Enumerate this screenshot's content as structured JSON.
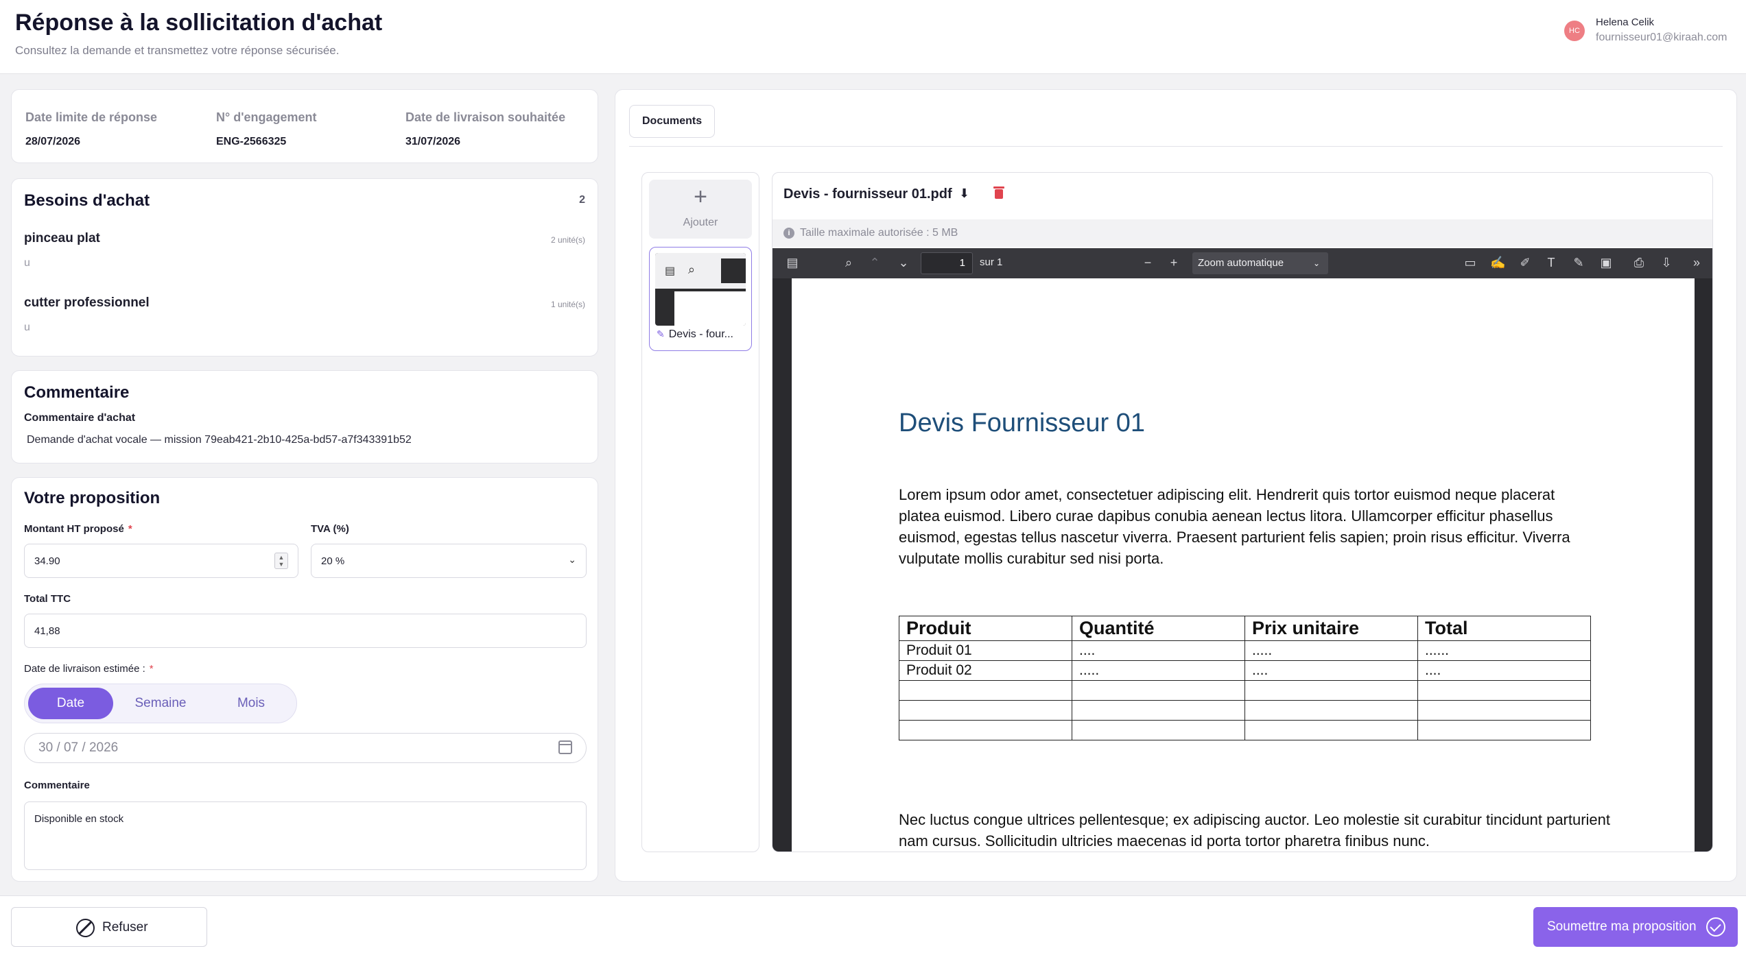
{
  "header": {
    "title": "Réponse à la sollicitation d'achat",
    "subtitle": "Consultez la demande et transmettez votre réponse sécurisée.",
    "user": {
      "initials": "HC",
      "name": "Helena Celik",
      "email": "fournisseur01@kiraah.com"
    }
  },
  "meta": {
    "deadline_label": "Date limite de réponse",
    "deadline_value": "28/07/2026",
    "engagement_label": "N° d'engagement",
    "engagement_value": "ENG-2566325",
    "delivery_label": "Date de livraison souhaitée",
    "delivery_value": "31/07/2026"
  },
  "needs": {
    "title": "Besoins d'achat",
    "count": "2",
    "items": [
      {
        "name": "pinceau plat",
        "qty": "2 unité(s)",
        "unit": "u"
      },
      {
        "name": "cutter professionnel",
        "qty": "1 unité(s)",
        "unit": "u"
      }
    ]
  },
  "comment": {
    "title": "Commentaire",
    "label": "Commentaire d'achat",
    "text": "Demande d'achat vocale — mission 79eab421-2b10-425a-bd57-a7f343391b52"
  },
  "proposal": {
    "title": "Votre proposition",
    "amount_label": "Montant HT proposé",
    "required_mark": "*",
    "amount_value": "34.90",
    "tva_label": "TVA (%)",
    "tva_value": "20 %",
    "total_label": "Total TTC",
    "total_value": "41,88",
    "delivery_label": "Date de livraison estimée :",
    "segments": [
      "Date",
      "Semaine",
      "Mois"
    ],
    "active_segment": "Date",
    "date_value": "30 / 07 / 2026",
    "comment_label": "Commentaire",
    "comment_value": "Disponible en stock"
  },
  "documents": {
    "tab_label": "Documents",
    "add_label": "Ajouter",
    "add_symbol": "+",
    "thumb_label": "Devis - four...",
    "file_name": "Devis - fournisseur 01.pdf",
    "max_size": "Taille maximale autorisée : 5 MB",
    "viewer": {
      "page_number": "1",
      "page_of": "sur 1",
      "zoom": "Zoom automatique"
    },
    "pdf": {
      "title": "Devis Fournisseur 01",
      "paragraph1": "Lorem ipsum odor amet, consectetuer adipiscing elit. Hendrerit quis tortor euismod neque placerat platea euismod. Libero curae dapibus conubia aenean lectus litora. Ullamcorper efficitur phasellus euismod, egestas tellus nascetur viverra. Praesent parturient felis sapien; proin risus efficitur. Viverra vulputate mollis curabitur sed nisi porta.",
      "table_header": [
        "Produit",
        "Quantité",
        "Prix unitaire",
        "Total"
      ],
      "table_rows": [
        [
          "Produit 01",
          "....",
          ".....",
          "......"
        ],
        [
          "Produit 02",
          ".....",
          "....",
          "...."
        ],
        [
          "",
          "",
          "",
          ""
        ],
        [
          "",
          "",
          "",
          ""
        ],
        [
          "",
          "",
          "",
          ""
        ]
      ],
      "paragraph2": "Nec luctus congue ultrices pellentesque; ex adipiscing auctor. Leo molestie sit curabitur tincidunt parturient nam cursus. Sollicitudin ultricies maecenas id porta tortor pharetra finibus nunc."
    }
  },
  "footer": {
    "refuse_label": "Refuser",
    "submit_label": "Soumettre ma proposition"
  },
  "colors": {
    "accent": "#7b5ce0",
    "submit": "#8a63ea",
    "danger": "#e0444e",
    "pdf_title": "#1e4e79"
  }
}
